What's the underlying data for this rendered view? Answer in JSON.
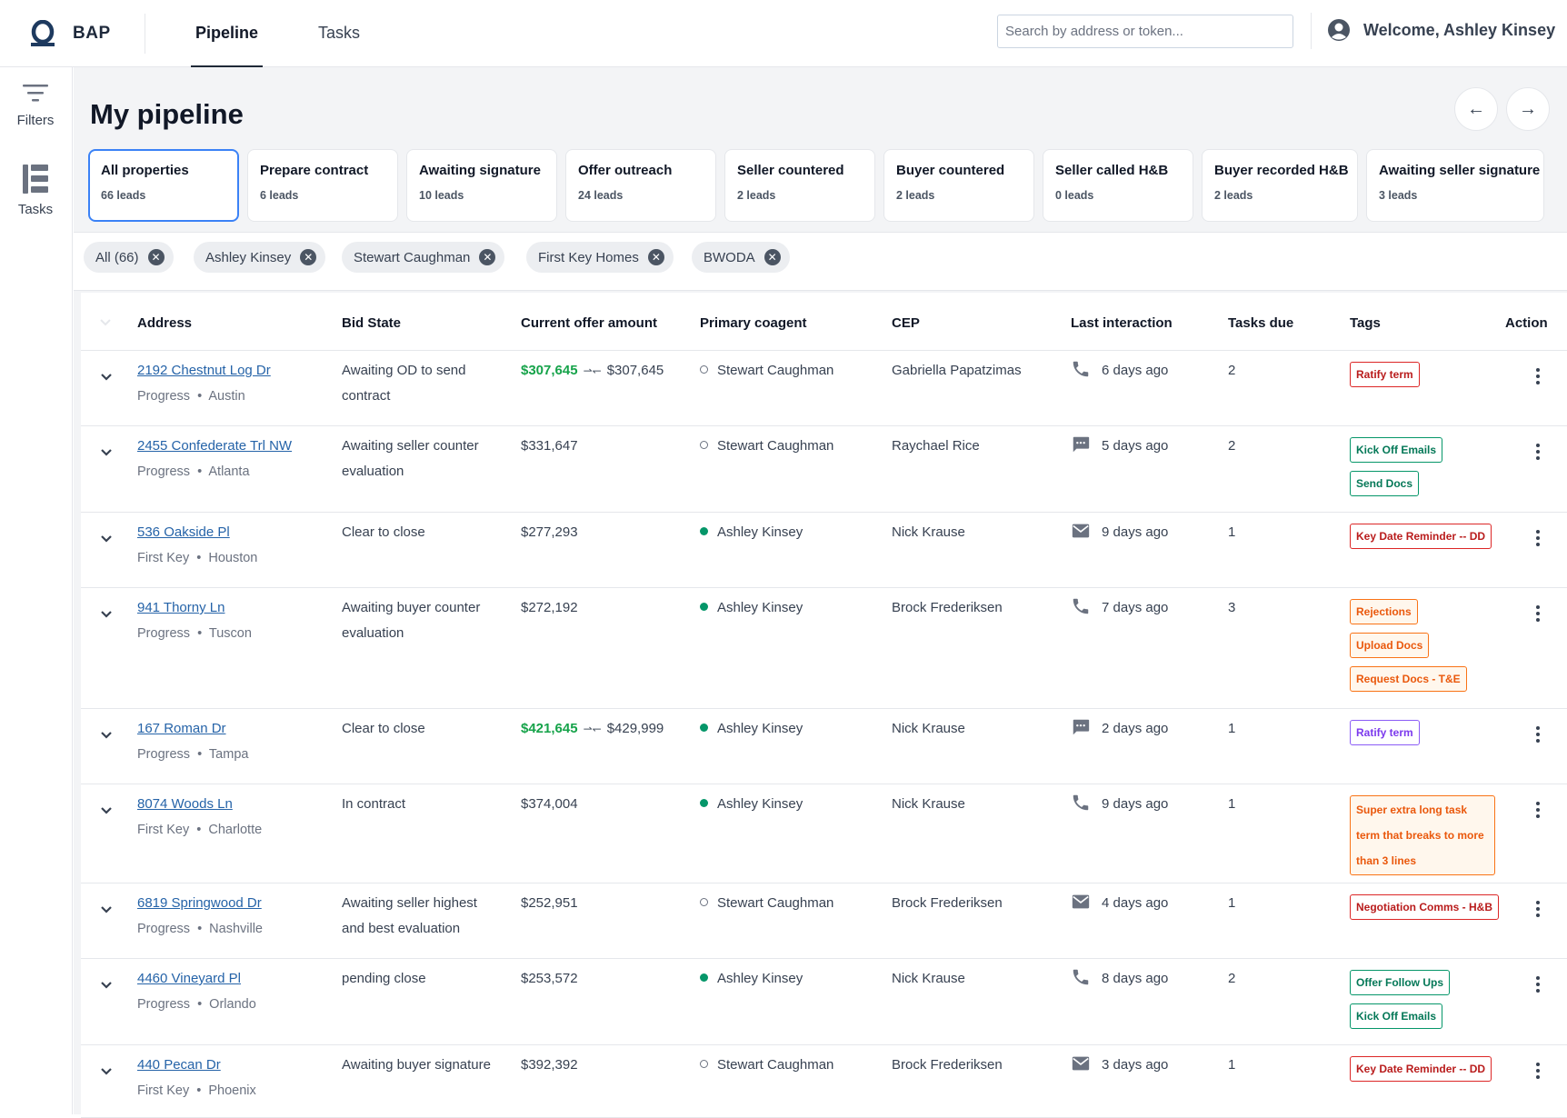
{
  "header": {
    "brand": "BAP",
    "tabs": [
      {
        "label": "Pipeline",
        "active": true
      },
      {
        "label": "Tasks",
        "active": false
      }
    ],
    "search_placeholder": "Search by address or token...",
    "welcome": "Welcome, Ashley Kinsey"
  },
  "sidebar": {
    "filters_label": "Filters",
    "tasks_label": "Tasks"
  },
  "page": {
    "title": "My pipeline",
    "prev_arrow": "←",
    "next_arrow": "→"
  },
  "stages": [
    {
      "name": "All properties",
      "count": "66 leads",
      "active": true
    },
    {
      "name": "Prepare contract",
      "count": "6 leads"
    },
    {
      "name": "Awaiting signature",
      "count": "10 leads"
    },
    {
      "name": "Offer outreach",
      "count": "24 leads"
    },
    {
      "name": "Seller countered",
      "count": "2 leads"
    },
    {
      "name": "Buyer countered",
      "count": "2 leads"
    },
    {
      "name": "Seller called H&B",
      "count": "0 leads"
    },
    {
      "name": "Buyer recorded H&B",
      "count": "2 leads"
    },
    {
      "name": "Awaiting seller signature",
      "count": "3 leads"
    }
  ],
  "filter_chips": [
    "All (66)",
    "Ashley Kinsey",
    "Stewart Caughman",
    "First Key Homes",
    "BWODA"
  ],
  "table": {
    "columns": [
      "Address",
      "Bid State",
      "Current offer amount",
      "Primary coagent",
      "CEP",
      "Last interaction",
      "Tasks due",
      "Tags",
      "Action"
    ],
    "rows": [
      {
        "address": "2192 Chestnut Log Dr",
        "program": "Progress",
        "city": "Austin",
        "bid_state": "Awaiting OD to send contract",
        "offer": "$307,645",
        "offer_prev": "$307,645",
        "offer_highlight": true,
        "coagent": "Stewart Caughman",
        "coagent_active": false,
        "cep": "Gabriella Papatzimas",
        "interaction_icon": "phone-icon",
        "last_interaction": "6 days ago",
        "tasks_due": "2",
        "tags": [
          {
            "label": "Ratify term",
            "color": "red"
          }
        ]
      },
      {
        "address": "2455 Confederate Trl NW",
        "program": "Progress",
        "city": "Atlanta",
        "bid_state": "Awaiting seller counter evaluation",
        "offer": "$331,647",
        "coagent": "Stewart Caughman",
        "coagent_active": false,
        "cep": "Raychael Rice",
        "interaction_icon": "chat-icon",
        "last_interaction": "5 days ago",
        "tasks_due": "2",
        "tags": [
          {
            "label": "Kick Off Emails",
            "color": "teal"
          },
          {
            "label": "Send Docs",
            "color": "teal"
          }
        ]
      },
      {
        "address": "536 Oakside Pl",
        "program": "First Key",
        "city": "Houston",
        "bid_state": "Clear to close",
        "offer": "$277,293",
        "coagent": "Ashley Kinsey",
        "coagent_active": true,
        "cep": "Nick Krause",
        "interaction_icon": "mail-icon",
        "last_interaction": "9 days ago",
        "tasks_due": "1",
        "tags": [
          {
            "label": "Key Date Reminder -- DD",
            "color": "red"
          }
        ]
      },
      {
        "address": "941 Thorny Ln",
        "program": "Progress",
        "city": "Tuscon",
        "bid_state": "Awaiting buyer counter evaluation",
        "offer": "$272,192",
        "coagent": "Ashley Kinsey",
        "coagent_active": true,
        "cep": "Brock Frederiksen",
        "interaction_icon": "phone-icon",
        "last_interaction": "7 days ago",
        "tasks_due": "3",
        "tags": [
          {
            "label": "Rejections",
            "color": "orange"
          },
          {
            "label": "Upload Docs",
            "color": "orange"
          },
          {
            "label": "Request Docs - T&E",
            "color": "orange"
          }
        ]
      },
      {
        "address": "167 Roman Dr",
        "program": "Progress",
        "city": "Tampa",
        "bid_state": "Clear to close",
        "offer": "$421,645",
        "offer_prev": "$429,999",
        "offer_highlight": true,
        "coagent": "Ashley Kinsey",
        "coagent_active": true,
        "cep": "Nick Krause",
        "interaction_icon": "chat-icon",
        "last_interaction": "2 days ago",
        "tasks_due": "1",
        "tags": [
          {
            "label": "Ratify term",
            "color": "purple"
          }
        ]
      },
      {
        "address": "8074 Woods Ln",
        "program": "First Key",
        "city": "Charlotte",
        "bid_state": "In contract",
        "offer": "$374,004",
        "coagent": "Ashley Kinsey",
        "coagent_active": true,
        "cep": "Nick Krause",
        "interaction_icon": "phone-icon",
        "last_interaction": "9 days ago",
        "tasks_due": "1",
        "tags": [
          {
            "label": "Super extra long task term that breaks to more than 3 lines",
            "color": "orange",
            "wrap": true
          }
        ]
      },
      {
        "address": "6819 Springwood Dr",
        "program": "Progress",
        "city": "Nashville",
        "bid_state": "Awaiting seller highest and best evaluation",
        "offer": "$252,951",
        "coagent": "Stewart Caughman",
        "coagent_active": false,
        "cep": "Brock Frederiksen",
        "interaction_icon": "mail-icon",
        "last_interaction": "4 days ago",
        "tasks_due": "1",
        "tags": [
          {
            "label": "Negotiation Comms - H&B",
            "color": "red"
          }
        ]
      },
      {
        "address": "4460 Vineyard Pl",
        "program": "Progress",
        "city": "Orlando",
        "bid_state": "pending close",
        "offer": "$253,572",
        "coagent": "Ashley Kinsey",
        "coagent_active": true,
        "cep": "Nick Krause",
        "interaction_icon": "phone-icon",
        "last_interaction": "8 days ago",
        "tasks_due": "2",
        "tags": [
          {
            "label": "Offer Follow Ups",
            "color": "teal"
          },
          {
            "label": "Kick Off Emails",
            "color": "teal"
          }
        ]
      },
      {
        "address": "440 Pecan Dr",
        "program": "First Key",
        "city": "Phoenix",
        "bid_state": "Awaiting buyer signature",
        "offer": "$392,392",
        "coagent": "Stewart Caughman",
        "coagent_active": false,
        "cep": "Brock Frederiksen",
        "interaction_icon": "mail-icon",
        "last_interaction": "3 days ago",
        "tasks_due": "1",
        "tags": [
          {
            "label": "Key Date Reminder -- DD",
            "color": "red"
          }
        ]
      }
    ]
  },
  "colors": {
    "accent_blue": "#3b82f6",
    "link": "#2563a8",
    "offer_green": "#16a34a",
    "active_dot": "#059669"
  }
}
